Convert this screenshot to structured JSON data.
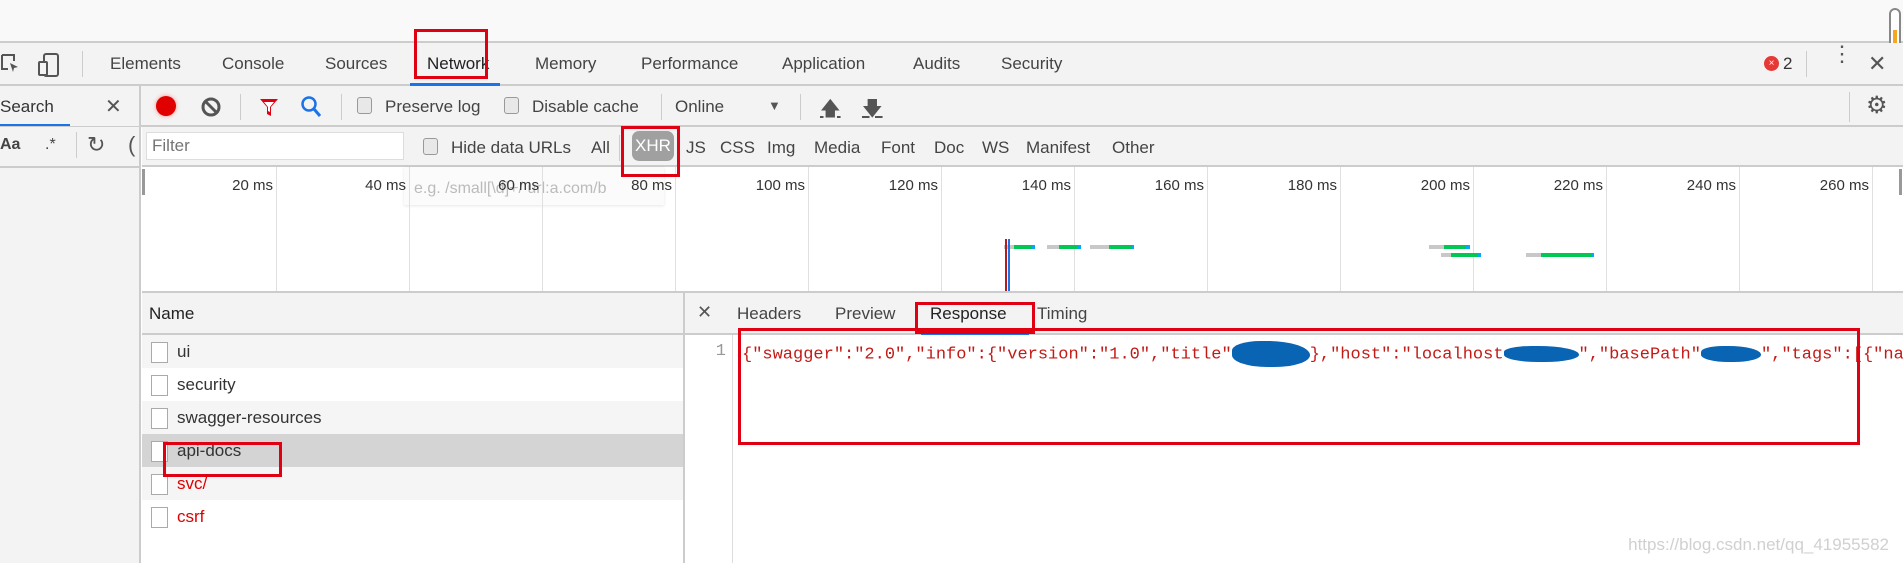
{
  "tabs": [
    "Elements",
    "Console",
    "Sources",
    "Network",
    "Memory",
    "Performance",
    "Application",
    "Audits",
    "Security"
  ],
  "active_tab": "Network",
  "error_count": "2",
  "sidebar": {
    "search_label": "Search",
    "case_label": "Aa",
    "regex_label": ".*"
  },
  "toolbar": {
    "preserve_log": "Preserve log",
    "disable_cache": "Disable cache",
    "throttle": "Online"
  },
  "filter": {
    "placeholder": "Filter",
    "hide_data_urls": "Hide data URLs",
    "types": [
      "All",
      "XHR",
      "JS",
      "CSS",
      "Img",
      "Media",
      "Font",
      "Doc",
      "WS",
      "Manifest",
      "Other"
    ],
    "active_type": "XHR",
    "tooltip": "e.g. /small[\\d]+/ url:a.com/b"
  },
  "timeline": {
    "ticks": [
      "20 ms",
      "40 ms",
      "60 ms",
      "80 ms",
      "100 ms",
      "120 ms",
      "140 ms",
      "160 ms",
      "180 ms",
      "200 ms",
      "220 ms",
      "240 ms",
      "260 ms"
    ],
    "bars": [
      {
        "row": 0,
        "start": 129.4,
        "wait": 131,
        "end": 134.1
      },
      {
        "row": 0,
        "start": 136,
        "wait": 137.8,
        "end": 141
      },
      {
        "row": 0,
        "start": 142.4,
        "wait": 145.3,
        "end": 149
      },
      {
        "row": 0,
        "start": 193.4,
        "wait": 195.6,
        "end": 199.5
      },
      {
        "row": 1,
        "start": 195.2,
        "wait": 196.7,
        "end": 201.2
      },
      {
        "row": 1,
        "start": 208,
        "wait": 210.2,
        "end": 218.2
      }
    ],
    "dom_content_loaded_ms": 129.6,
    "load_ms": 130.1
  },
  "requests": {
    "header": "Name",
    "items": [
      {
        "name": "ui",
        "error": false
      },
      {
        "name": "security",
        "error": false
      },
      {
        "name": "swagger-resources",
        "error": false
      },
      {
        "name": "api-docs",
        "error": false,
        "selected": true
      },
      {
        "name": "svc/",
        "error": true
      },
      {
        "name": "csrf",
        "error": true
      }
    ]
  },
  "detail": {
    "tabs": [
      "Headers",
      "Preview",
      "Response",
      "Timing"
    ],
    "active": "Response",
    "line_number": "1",
    "code_segments": [
      "{\"swagger\":\"2.0\",\"info\":{\"version\":\"1.0\",\"title\"",
      "},\"host\":\"localhost",
      "\",\"basePath\"",
      "\",\"tags\":[{\"name"
    ]
  },
  "watermark": "https://blog.csdn.net/qq_41955582",
  "colors": {
    "accent": "#1a73e8",
    "record": "#e00000",
    "error": "#e00000",
    "annotation": "#e00012",
    "redaction": "#0a64b4",
    "wait": "#00c853",
    "download": "#03a9f4"
  }
}
